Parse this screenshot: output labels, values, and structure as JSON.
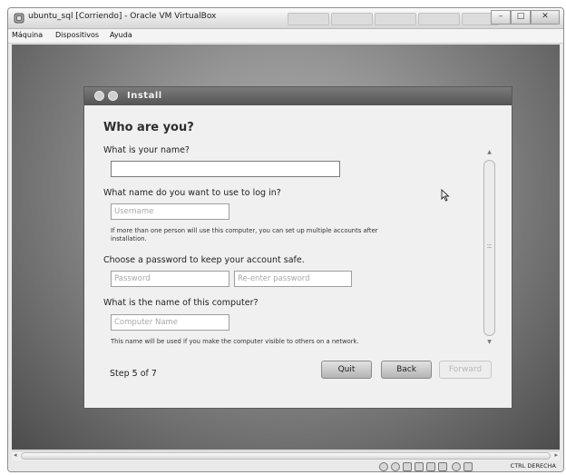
{
  "window": {
    "title": "ubuntu_sql [Corriendo] - Oracle VM VirtualBox",
    "minimize_symbol": "–",
    "maximize_symbol": "□",
    "close_symbol": "✕"
  },
  "menubar": {
    "items": [
      "Máquina",
      "Dispositivos",
      "Ayuda"
    ]
  },
  "dialog": {
    "title": "Install",
    "heading": "Who are you?",
    "name_question": "What is your name?",
    "name_value": "",
    "login_question": "What name do you want to use to log in?",
    "username_placeholder": "Username",
    "login_note_line1": "If more than one person will use this computer, you can set up multiple accounts after",
    "login_note_line2": "installation.",
    "password_question": "Choose a password to keep your account safe.",
    "password_placeholder": "Password",
    "reenter_placeholder": "Re-enter password",
    "computer_question": "What is the name of this computer?",
    "computer_placeholder": "Computer Name",
    "computer_note": "This name will be used if you make the computer visible to others on a network.",
    "step": "Step 5 of 7",
    "buttons": {
      "quit": "Quit",
      "back": "Back",
      "forward": "Forward"
    }
  },
  "statusbar": {
    "host_key": "CTRL DERECHA"
  },
  "icons": [
    "virtualbox-icon",
    "cursor-icon",
    "hard-disk-icon",
    "optical-drive-icon",
    "usb-icon",
    "shared-folders-icon",
    "network-icon",
    "display-icon",
    "recording-icon",
    "mouse-integration-icon"
  ]
}
